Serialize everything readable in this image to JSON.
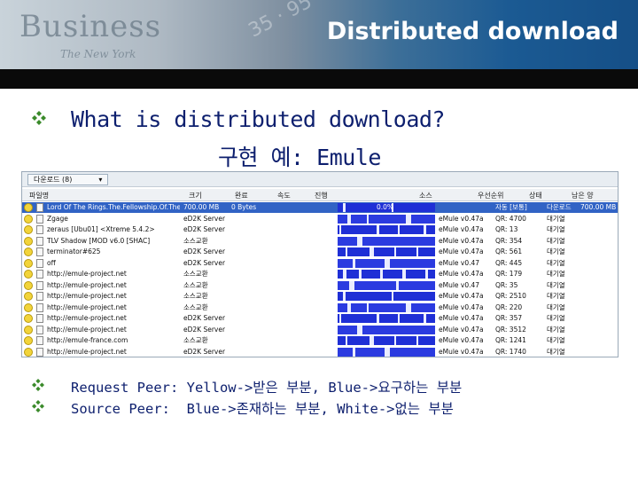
{
  "header": {
    "title": "Distributed download",
    "art_text": "Business",
    "art_sub": "The New York",
    "art_nums": "35 · 95"
  },
  "heading": "What is distributed download?",
  "subheading": "구현 예: Emule",
  "screenshot": {
    "tab_label": "다운로드 (8)",
    "columns": [
      "파일명",
      "크기",
      "완료",
      "속도",
      "진행",
      "소스",
      "우선순위",
      "상태",
      "남은 양"
    ],
    "rows": [
      {
        "name": "Lord Of The Rings.The.Fellowship.Of.The.Rin...",
        "size": "700.00 MB",
        "done": "0 Bytes",
        "speed": "",
        "progress_text": "0.0%",
        "source": "",
        "priority": "자동 [보통]",
        "state": "다운로드",
        "remaining": "700.00 MB"
      },
      {
        "name": "Zgage",
        "size": "eD2K Server",
        "done": "",
        "speed": "",
        "progress_text": "",
        "source": "eMule v0.47a",
        "priority": "QR: 4700",
        "state": "대기열",
        "remaining": ""
      },
      {
        "name": "zeraus [Ubu01] <Xtreme 5.4.2>",
        "size": "eD2K Server",
        "done": "",
        "speed": "",
        "progress_text": "",
        "source": "eMule v0.47a",
        "priority": "QR: 13",
        "state": "대기열",
        "remaining": ""
      },
      {
        "name": "TLV Shadow [MOD v6.0 [SHAC]",
        "size": "소스교환",
        "done": "",
        "speed": "",
        "progress_text": "",
        "source": "eMule v0.47a",
        "priority": "QR: 354",
        "state": "대기열",
        "remaining": ""
      },
      {
        "name": "terminator#625",
        "size": "eD2K Server",
        "done": "",
        "speed": "",
        "progress_text": "",
        "source": "eMule v0.47a",
        "priority": "QR: 561",
        "state": "대기열",
        "remaining": ""
      },
      {
        "name": "off",
        "size": "eD2K Server",
        "done": "",
        "speed": "",
        "progress_text": "",
        "source": "eMule v0.47",
        "priority": "QR: 445",
        "state": "대기열",
        "remaining": ""
      },
      {
        "name": "http://emule-project.net",
        "size": "소스교환",
        "done": "",
        "speed": "",
        "progress_text": "",
        "source": "eMule v0.47a",
        "priority": "QR: 179",
        "state": "대기열",
        "remaining": ""
      },
      {
        "name": "http://emule-project.net",
        "size": "소스교환",
        "done": "",
        "speed": "",
        "progress_text": "",
        "source": "eMule v0.47",
        "priority": "QR: 35",
        "state": "대기열",
        "remaining": ""
      },
      {
        "name": "http://emule-project.net",
        "size": "소스교환",
        "done": "",
        "speed": "",
        "progress_text": "",
        "source": "eMule v0.47a",
        "priority": "QR: 2510",
        "state": "대기열",
        "remaining": ""
      },
      {
        "name": "http://emule-project.net",
        "size": "소스교환",
        "done": "",
        "speed": "",
        "progress_text": "",
        "source": "eMule v0.47a",
        "priority": "QR: 220",
        "state": "대기열",
        "remaining": ""
      },
      {
        "name": "http://emule-project.net",
        "size": "eD2K Server",
        "done": "",
        "speed": "",
        "progress_text": "",
        "source": "eMule v0.47a",
        "priority": "QR: 357",
        "state": "대기열",
        "remaining": ""
      },
      {
        "name": "http://emule-project.net",
        "size": "eD2K Server",
        "done": "",
        "speed": "",
        "progress_text": "",
        "source": "eMule v0.47a",
        "priority": "QR: 3512",
        "state": "대기열",
        "remaining": ""
      },
      {
        "name": "http://emule-france.com",
        "size": "소스교환",
        "done": "",
        "speed": "",
        "progress_text": "",
        "source": "eMule v0.47a",
        "priority": "QR: 1241",
        "state": "대기열",
        "remaining": ""
      },
      {
        "name": "http://emule-project.net",
        "size": "eD2K Server",
        "done": "",
        "speed": "",
        "progress_text": "",
        "source": "eMule v0.47a",
        "priority": "QR: 1740",
        "state": "대기열",
        "remaining": ""
      }
    ]
  },
  "bullets": [
    "Request Peer: Yellow->받은 부분, Blue->요구하는 부분",
    "Source Peer:  Blue->존재하는 부분, White->없는 부분"
  ],
  "colors": {
    "text": "#0d1f6e",
    "bullet": "#3a8a2a",
    "selection": "#3163c5",
    "bar_blue": "#1f2fd6"
  },
  "icons": {
    "bullet": "diamond-bullet-icon",
    "peer": "smiley-peer-icon",
    "file": "file-icon"
  }
}
